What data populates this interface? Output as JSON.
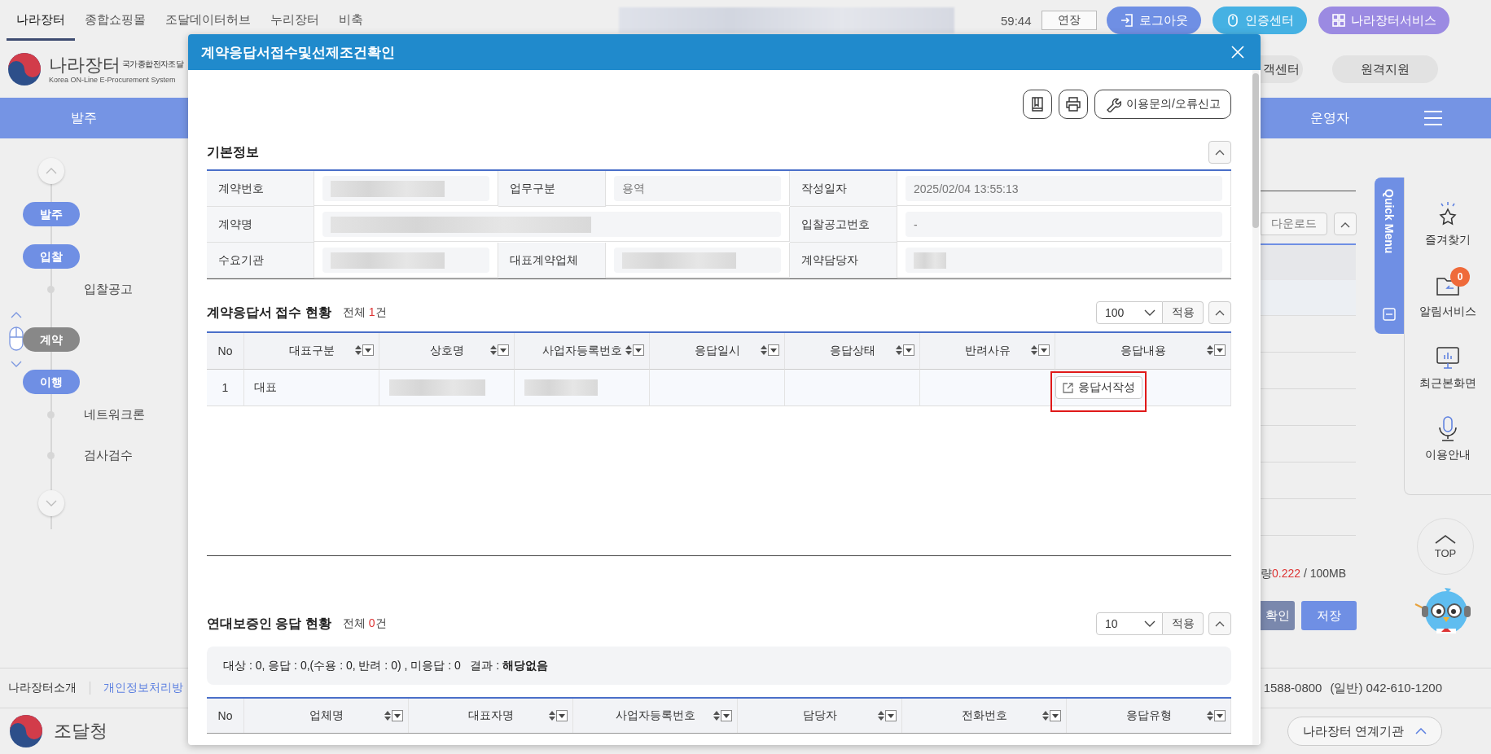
{
  "top_bar": {
    "sites": [
      {
        "label": "나라장터",
        "selected": true
      },
      {
        "label": "종합쇼핑몰",
        "selected": false
      },
      {
        "label": "조달데이터허브",
        "selected": false
      },
      {
        "label": "누리장터",
        "selected": false
      },
      {
        "label": "비축",
        "selected": false
      }
    ],
    "timer": "59:44",
    "extend_button": "연장",
    "logout_button": "로그아웃",
    "cert_button": "인증센터",
    "service_button": "나라장터서비스"
  },
  "header": {
    "logo_title": "나라장터",
    "logo_subtitle": "국가종합전자조달",
    "logo_english": "Korea ON-Line E-Procurement System",
    "buttons": [
      "객센터",
      "원격지원"
    ]
  },
  "nav": {
    "left": "발주",
    "right": "운영자"
  },
  "sidebar": {
    "stages": [
      {
        "label": "발주",
        "selected": false
      },
      {
        "label": "입찰",
        "selected": false,
        "children": [
          {
            "label": "입찰공고"
          }
        ]
      },
      {
        "label": "계약",
        "selected": true
      },
      {
        "label": "이행",
        "selected": false,
        "children": [
          {
            "label": "네트워크론"
          },
          {
            "label": "검사검수"
          }
        ]
      }
    ]
  },
  "background_panel": {
    "download_button": "다운로드",
    "storage_label": "량",
    "storage_used": "0.222",
    "storage_total": "/ 100MB",
    "confirm_button": "확인",
    "save_button": "저장"
  },
  "quick_menu": {
    "title": "Quick Menu",
    "items": [
      {
        "kind": "star",
        "label": "즐겨찾기"
      },
      {
        "kind": "folder",
        "label": "알림서비스",
        "badge": "0"
      },
      {
        "kind": "monitor",
        "label": "최근본화면"
      },
      {
        "kind": "mic",
        "label": "이용안내"
      }
    ],
    "top_button": "TOP"
  },
  "footer": {
    "links": [
      {
        "label": "나라장터소개",
        "color": "#333333"
      },
      {
        "label": "개인정보처리방",
        "color": "#5b7fe0"
      }
    ],
    "phone_1": "1588-0800",
    "phone_2": "(일반) 042-610-1200",
    "agency": "조달청",
    "related_button": "나라장터 연계기관"
  },
  "modal": {
    "title": "계약응답서접수및선제조건확인",
    "help_button": "이용문의/오류신고",
    "basic_info": {
      "title": "기본정보",
      "rows": [
        [
          {
            "label": "계약번호",
            "redacted": true
          },
          {
            "label": "업무구분",
            "value": "용역"
          },
          {
            "label": "작성일자",
            "value": "2025/02/04 13:55:13"
          }
        ],
        [
          {
            "label": "계약명",
            "redacted": true
          },
          "",
          {
            "label": "입찰공고번호",
            "value": "-"
          }
        ],
        [
          {
            "label": "수요기관",
            "redacted": true
          },
          {
            "label": "대표계약업체",
            "redacted": true
          },
          {
            "label": "계약담당자",
            "redacted": true
          }
        ]
      ]
    },
    "responses": {
      "title": "계약응답서 접수 현황",
      "total_label": "전체",
      "total_count": "1",
      "total_unit": "건",
      "page_size": "100",
      "apply_button": "적용",
      "columns": [
        {
          "label": "No",
          "sortable": false
        },
        {
          "label": "대표구분",
          "sortable": true
        },
        {
          "label": "상호명",
          "sortable": true
        },
        {
          "label": "사업자등록번호",
          "sortable": true
        },
        {
          "label": "응답일시",
          "sortable": true
        },
        {
          "label": "응답상태",
          "sortable": true
        },
        {
          "label": "반려사유",
          "sortable": true
        },
        {
          "label": "응답내용",
          "sortable": true
        }
      ],
      "rows": [
        {
          "no": "1",
          "type": "대표",
          "company_redacted": true,
          "business_number_redacted": true,
          "action_button": "응답서작성",
          "action_highlighted": true
        }
      ]
    },
    "guarantors": {
      "title": "연대보증인 응답 현황",
      "total_label": "전체",
      "total_count": "0",
      "total_unit": "건",
      "page_size": "10",
      "apply_button": "적용",
      "summary": "대상 : 0, 응답 : 0,(수용 : 0, 반려 : 0) , 미응답 : 0   결과 : **해당없음**",
      "columns": [
        {
          "label": "No",
          "sortable": false
        },
        {
          "label": "업체명",
          "sortable": true
        },
        {
          "label": "대표자명",
          "sortable": true
        },
        {
          "label": "사업자등록번호",
          "sortable": true
        },
        {
          "label": "담당자",
          "sortable": true
        },
        {
          "label": "전화번호",
          "sortable": true
        },
        {
          "label": "응답유형",
          "sortable": true
        }
      ]
    }
  }
}
